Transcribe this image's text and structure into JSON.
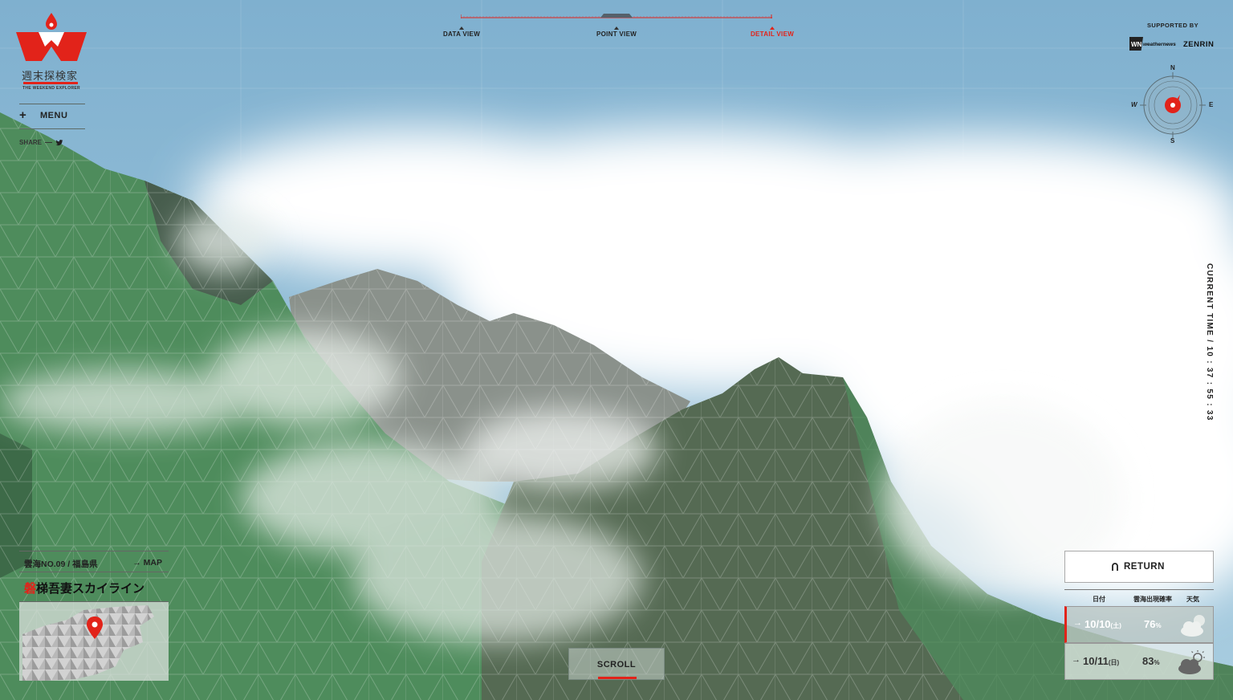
{
  "brand": {
    "title": "週末探検家",
    "subtitle": "THE WEEKEND EXPLORER",
    "accent": "#e2231a"
  },
  "menu": {
    "icon": "plus-icon",
    "label": "MENU"
  },
  "share": {
    "label": "SHARE",
    "icon": "twitter-icon"
  },
  "views": [
    {
      "label": "DATA VIEW",
      "active": false
    },
    {
      "label": "POINT VIEW",
      "active": false
    },
    {
      "label": "DETAIL VIEW",
      "active": true
    }
  ],
  "supported": {
    "label": "SUPPORTED BY",
    "sponsor1": "weathernews",
    "sponsor2": "ZENRIN"
  },
  "compass": {
    "n": "N",
    "e": "E",
    "s": "S",
    "w": "W"
  },
  "current_time": {
    "label": "CURRENT TIME / 10 : 37 : 55 : 33"
  },
  "location": {
    "number": "雲海NO.09 / 福島県",
    "map_link": "MAP",
    "name_first": "磐",
    "name_rest": "梯吾妻スカイライン"
  },
  "scroll": {
    "label": "SCROLL"
  },
  "return": {
    "label": "RETURN"
  },
  "forecast": {
    "headers": {
      "date": "日付",
      "prob": "雲海出現確率",
      "weather": "天気"
    },
    "rows": [
      {
        "date": "10/10",
        "dow": "(土)",
        "prob": "76",
        "unit": "%",
        "weather_icon": "cloudy-icon",
        "selected": true
      },
      {
        "date": "10/11",
        "dow": "(日)",
        "prob": "83",
        "unit": "%",
        "weather_icon": "sun-cloud-icon",
        "selected": false
      }
    ]
  },
  "colors": {
    "sky": "#7fb0cf",
    "mountain": "#4e8c5c",
    "mountain_dark": "#556a53",
    "cloud": "#ffffff"
  }
}
